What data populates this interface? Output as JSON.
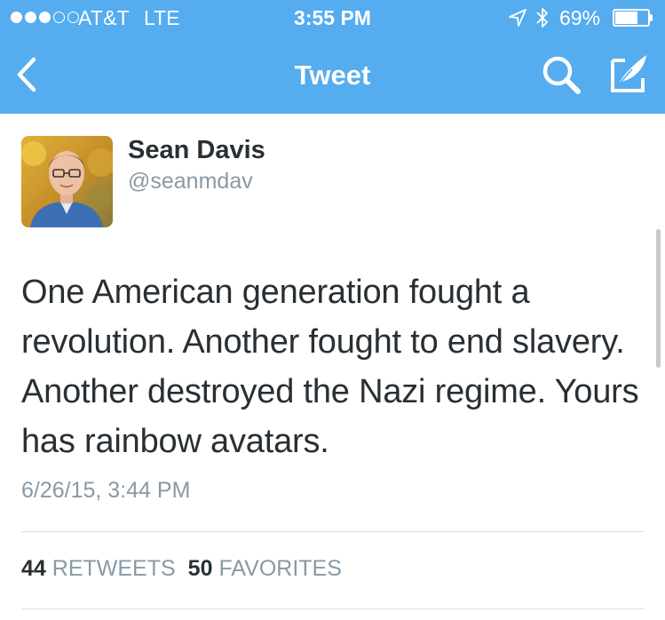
{
  "status_bar": {
    "carrier": "AT&T",
    "network": "LTE",
    "time": "3:55 PM",
    "battery_percent": "69%",
    "battery_level": 0.69,
    "signal_bars_filled": 3,
    "signal_bars_total": 5
  },
  "nav": {
    "title": "Tweet",
    "back_icon": "chevron-left-icon",
    "search_icon": "search-icon",
    "compose_icon": "compose-icon"
  },
  "tweet": {
    "author_name": "Sean Davis",
    "author_handle": "@seanmdav",
    "text": "One American generation fought a revolution. Another fought to end slavery. Another destroyed the Nazi regime. Yours has rainbow avatars.",
    "timestamp": "6/26/15, 3:44 PM",
    "retweets_count": "44",
    "retweets_label": "RETWEETS",
    "favorites_count": "50",
    "favorites_label": "FAVORITES"
  },
  "colors": {
    "brand": "#55acee",
    "text_primary": "#292f33",
    "text_secondary": "#8899a6"
  }
}
